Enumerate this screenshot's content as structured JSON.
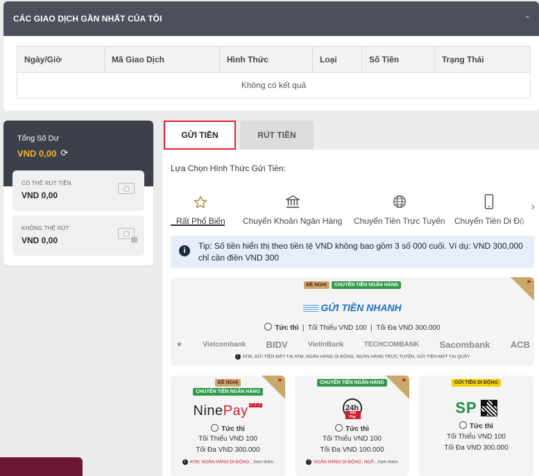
{
  "transactions": {
    "title": "CÁC GIAO DỊCH GẦN NHẤT CỦA TÔI",
    "columns": [
      "Ngày/Giờ",
      "Mã Giao Dịch",
      "Hình Thức",
      "Loại",
      "Số Tiền",
      "Trạng Thái"
    ],
    "empty_text": "Không có kết quả",
    "collapse_icon": "chevron-up-icon"
  },
  "balance": {
    "total_label": "Tổng Số Dư",
    "total_value": "VND  0,00",
    "withdrawable_label": "CÓ THỂ RÚT TIỀN",
    "withdrawable_value": "VND  0,00",
    "non_withdrawable_label": "KHÔNG THỂ RÚT",
    "non_withdrawable_value": "VND  0,00"
  },
  "tabs": {
    "deposit": "GỬI TIỀN",
    "withdraw": "RÚT TIỀN"
  },
  "deposit": {
    "choose_label": "Lựa Chọn Hình Thức Gửi Tiền:",
    "methods": [
      {
        "label": "Rất Phổ Biến",
        "icon": "star-icon"
      },
      {
        "label": "Chuyển Khoản Ngân Hàng",
        "icon": "bank-icon"
      },
      {
        "label": "Chuyển Tiền Trực Tuyến",
        "icon": "globe-icon"
      },
      {
        "label": "Chuyển Tiền Di Độ",
        "icon": "mobile-icon"
      }
    ],
    "tip": "Tip: Số tiền hiển thị theo tiền tệ VND không bao gồm 3 số 000 cuối. Ví dụ: VND 300,000 chỉ cần điền VND 300"
  },
  "featured": {
    "badge_recommended": "ĐỀ NGHỊ",
    "badge_category": "CHUYỂN TIỀN NGÂN HÀNG",
    "logo_text": "GỬI TIỀN NHANH",
    "speed": "Tức thì",
    "min": "Tối Thiểu VND 100",
    "max": "Tối Đa VND 300.000",
    "banks": [
      "Vietcombank",
      "BIDV",
      "VietinBank",
      "TECHCOMBANK",
      "Sacombank",
      "ACB"
    ],
    "note": "ATM, GỬI TIỀN MẶT TẠI ATM, NGÂN HÀNG DI ĐỘNG, NGÂN HÀNG TRỰC TUYẾN, GỬI TIỀN MẶT TẠI QUẦY"
  },
  "cards": [
    {
      "badge_recommended": "ĐỀ NGHỊ",
      "badge_category": "CHUYỂN TIỀN NGÂN HÀNG",
      "logo": "NinePay",
      "speed": "Tức thì",
      "min": "Tối Thiểu VND 100",
      "max": "Tối Đa VND 300.000",
      "note": "ATM, NGÂN HÀNG DI ĐỘNG...",
      "more": "Xem thêm"
    },
    {
      "badge_category": "CHUYỂN TIỀN NGÂN HÀNG",
      "logo": "24h",
      "speed": "Tức thì",
      "min": "Tối Thiểu VND 100",
      "max": "Tối Đa VND 100.000",
      "note": "NGÂN HÀNG DI ĐỘNG, NGÂ...",
      "more": "Xem thêm"
    },
    {
      "badge_category": "GỬI TIỀN DI ĐỘNG",
      "logo": "SP",
      "speed": "Tức thì",
      "min": "Tối Thiểu VND 100",
      "max": "Tối Đa VND 300.000"
    }
  ],
  "colors": {
    "header_bg": "#4b505c",
    "balance_bg": "#3b404b",
    "balance_accent": "#f5b12a",
    "active_tab_border": "#e01f2d",
    "tip_bg": "#e5eefa",
    "badge_green": "#2f9a4a",
    "badge_gold": "#c9a96b"
  }
}
